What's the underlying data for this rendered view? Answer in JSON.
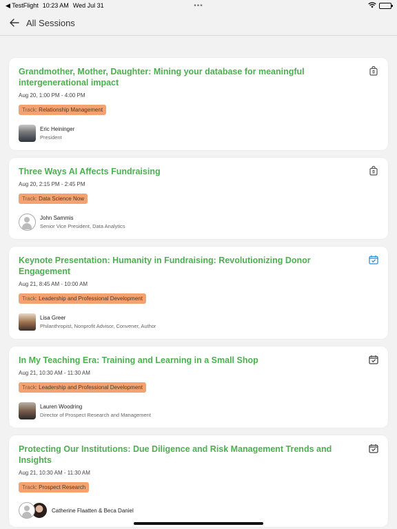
{
  "statusbar": {
    "app": "◀ TestFlight",
    "time": "10:23 AM",
    "date": "Wed Jul 31",
    "dots": "•••"
  },
  "navbar": {
    "back_icon": "arrow-left-icon",
    "title": "All Sessions"
  },
  "sessions": [
    {
      "title": "Grandmother, Mother, Daughter: Mining your database for meaningful intergenerational impact",
      "time": "Aug 20, 1:00 PM - 4:00 PM",
      "track_prefix": "Track:",
      "track": "Relationship Management",
      "speaker_name": "Eric Heininger",
      "speaker_role": "President",
      "icon": "shopping-bag-icon"
    },
    {
      "title": "Three Ways AI Affects Fundraising",
      "time": "Aug 20, 2:15 PM - 2:45 PM",
      "track_prefix": "Track:",
      "track": "Data Science Now",
      "speaker_name": "John Sammis",
      "speaker_role": "Senior Vice President, Data Analytics",
      "icon": "shopping-bag-icon"
    },
    {
      "title": "Keynote Presentation: Humanity in Fundraising: Revolutionizing Donor Engagement",
      "time": "Aug 21, 8:45 AM - 10:00 AM",
      "track_prefix": "Track:",
      "track": "Leadership and Professional Development",
      "speaker_name": "Lisa Greer",
      "speaker_role": "Philanthropist, Nonprofit Advisor, Convener, Author",
      "icon": "calendar-check-icon"
    },
    {
      "title": "In My Teaching Era: Training and Learning in a Small Shop",
      "time": "Aug 21, 10:30 AM - 11:30 AM",
      "track_prefix": "Track:",
      "track": "Leadership and Professional Development",
      "speaker_name": "Lauren Woodring",
      "speaker_role": "Director of Prospect Research and Management",
      "icon": "calendar-check-icon"
    },
    {
      "title": "Protecting Our Institutions: Due Diligence and Risk Management Trends and Insights",
      "time": "Aug 21, 10:30 AM - 11:30 AM",
      "track_prefix": "Track:",
      "track": "Prospect Research",
      "speaker_name": "Catherine Flaatten & Beca Daniel",
      "icon": "calendar-check-icon"
    }
  ],
  "colors": {
    "title_green": "#4caf50",
    "track_orange": "#f4a26f",
    "calendar_active_blue": "#2a8fd6"
  }
}
